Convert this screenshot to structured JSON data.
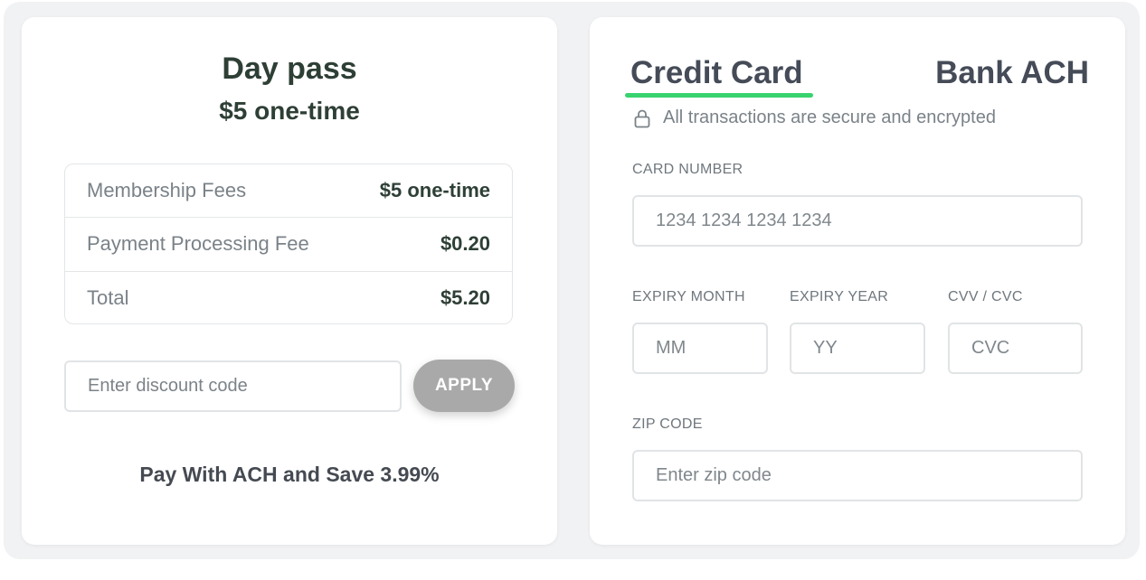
{
  "plan": {
    "title": "Day pass",
    "price": "$5 one-time"
  },
  "fees": [
    {
      "label": "Membership Fees",
      "value": "$5 one-time"
    },
    {
      "label": "Payment Processing Fee",
      "value": "$0.20"
    },
    {
      "label": "Total",
      "value": "$5.20"
    }
  ],
  "discount": {
    "placeholder": "Enter discount code",
    "value": "",
    "apply_label": "APPLY"
  },
  "ach_promo": "Pay With ACH and Save 3.99%",
  "tabs": {
    "active": "Credit Card",
    "items": [
      {
        "label": "Credit Card"
      },
      {
        "label": "Bank ACH"
      }
    ]
  },
  "secure_note": "All transactions are secure and encrypted",
  "form": {
    "card_number": {
      "label": "CARD NUMBER",
      "placeholder": "1234 1234 1234 1234"
    },
    "expiry_month": {
      "label": "EXPIRY MONTH",
      "placeholder": "MM"
    },
    "expiry_year": {
      "label": "EXPIRY YEAR",
      "placeholder": "YY"
    },
    "cvv": {
      "label": "CVV / CVC",
      "placeholder": "CVC"
    },
    "zip": {
      "label": "ZIP CODE",
      "placeholder": "Enter zip code"
    }
  },
  "colors": {
    "accent": "#38d36f",
    "heading": "#2e3f36",
    "button_disabled": "#a9a9a9",
    "background": "#f1f2f4"
  },
  "icons": {
    "secure": "lock-icon"
  }
}
